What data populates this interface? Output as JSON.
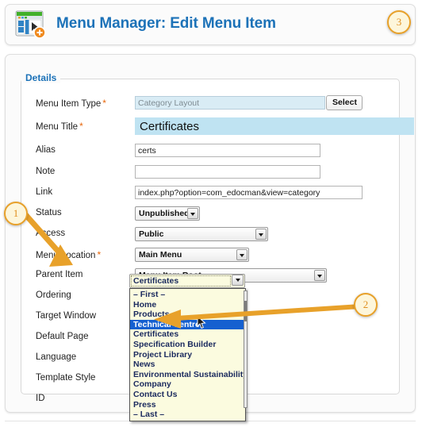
{
  "header": {
    "title": "Menu Manager: Edit Menu Item",
    "icon": "menu-manager-icon"
  },
  "fieldset": {
    "legend": "Details"
  },
  "fields": [
    {
      "label": "Menu Item Type",
      "required": true,
      "control": "readonly-text",
      "value": "Category Layout",
      "button": "Select"
    },
    {
      "label": "Menu Title",
      "required": true,
      "control": "title-text",
      "value": "Certificates"
    },
    {
      "label": "Alias",
      "required": false,
      "control": "text",
      "value": "certs"
    },
    {
      "label": "Note",
      "required": false,
      "control": "text",
      "value": ""
    },
    {
      "label": "Link",
      "required": false,
      "control": "text",
      "value": "index.php?option=com_edocman&view=category"
    },
    {
      "label": "Status",
      "required": false,
      "control": "select",
      "value": "Unpublished"
    },
    {
      "label": "Access",
      "required": false,
      "control": "select",
      "value": "Public"
    },
    {
      "label": "Menu Location",
      "required": true,
      "control": "select",
      "value": "Main Menu"
    },
    {
      "label": "Parent Item",
      "required": false,
      "control": "select",
      "value": "Menu Item Root"
    },
    {
      "label": "Ordering",
      "required": false,
      "control": "combo-open",
      "value": "Certificates"
    },
    {
      "label": "Target Window",
      "required": false,
      "control": "none",
      "value": ""
    },
    {
      "label": "Default Page",
      "required": false,
      "control": "none",
      "value": ""
    },
    {
      "label": "Language",
      "required": false,
      "control": "none",
      "value": ""
    },
    {
      "label": "Template Style",
      "required": false,
      "control": "none",
      "value": ""
    },
    {
      "label": "ID",
      "required": false,
      "control": "none",
      "value": ""
    }
  ],
  "ordering_dropdown": {
    "selected": "Technical Centre",
    "options": [
      "– First –",
      "Home",
      "Products",
      "Technical Centre",
      "Certificates",
      "Specification Builder",
      "Project Library",
      "News",
      "Environmental Sustainability",
      "Company",
      "Contact Us",
      "Press",
      "– Last –"
    ]
  },
  "callouts": [
    {
      "number": "1"
    },
    {
      "number": "2"
    },
    {
      "number": "3"
    }
  ],
  "colors": {
    "title_blue": "#1c72b8",
    "accent_orange": "#e8a12a",
    "highlight_blue": "#1560d0",
    "dropdown_cream": "#fbfbdf",
    "field_highlight": "#bfe3f2"
  }
}
